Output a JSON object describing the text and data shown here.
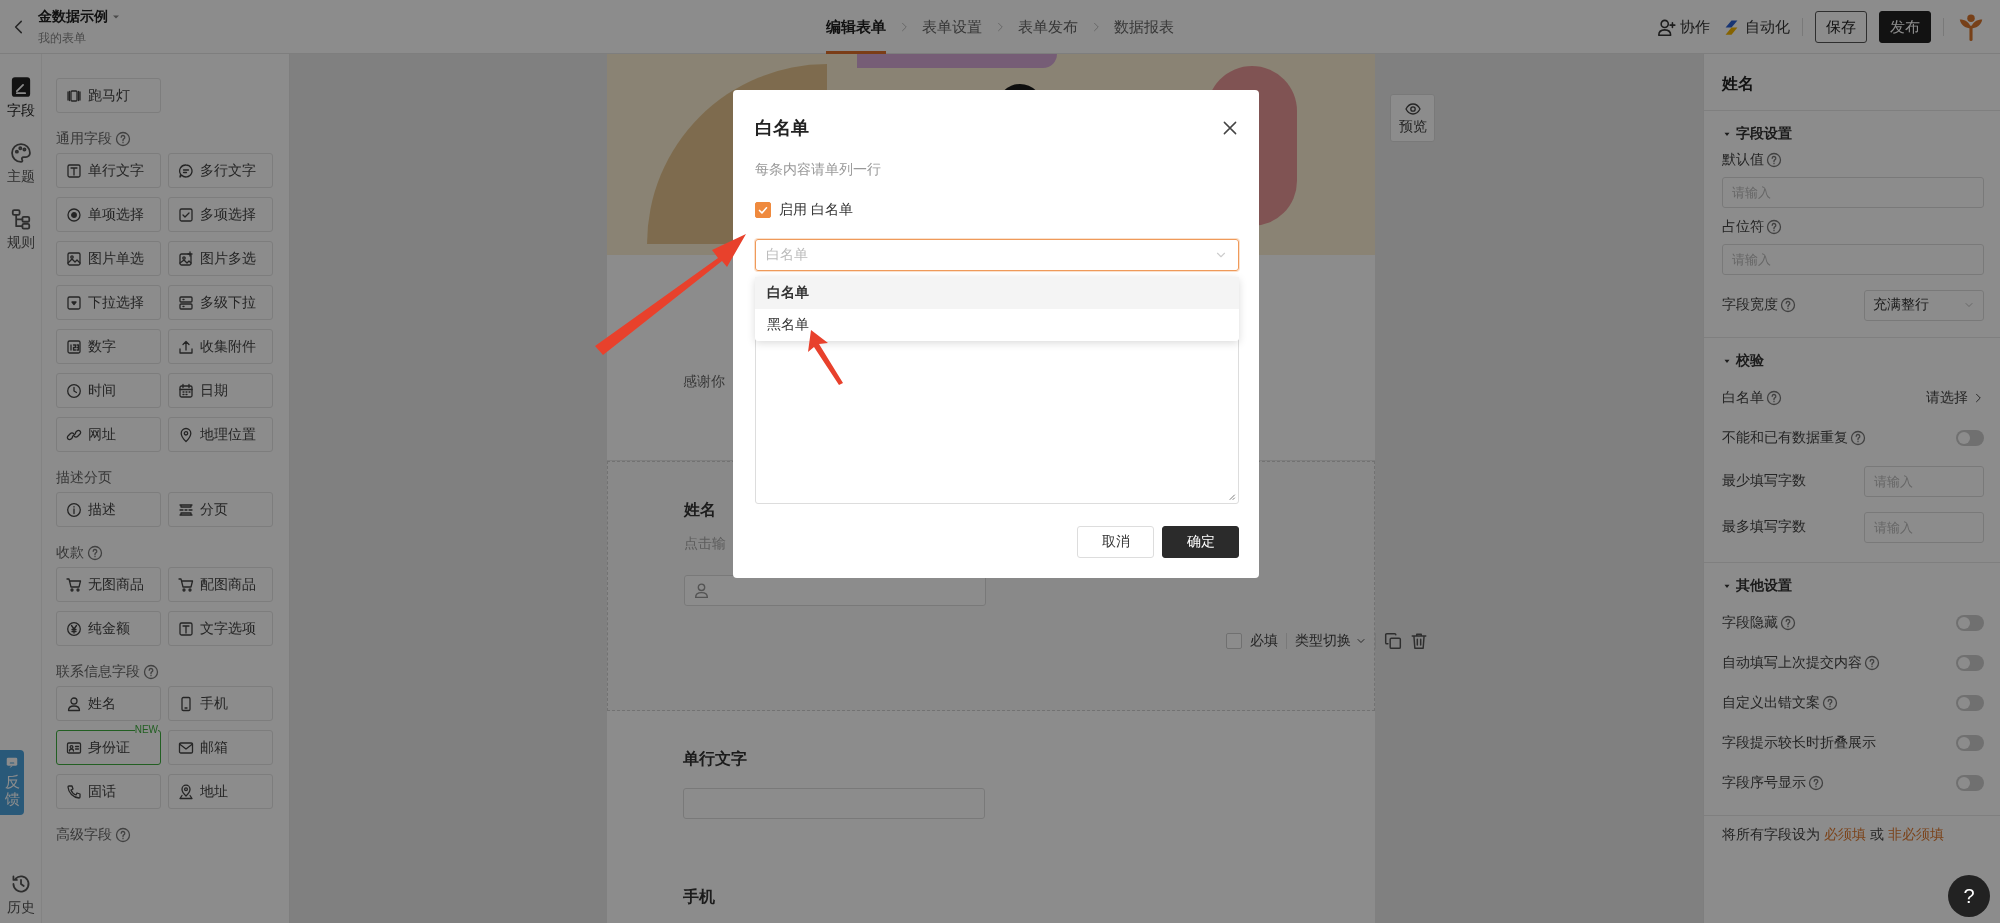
{
  "header": {
    "title": "金数据示例",
    "subtitle": "我的表单",
    "steps": [
      {
        "label": "编辑表单",
        "selected": true
      },
      {
        "label": "表单设置",
        "selected": false
      },
      {
        "label": "表单发布",
        "selected": false
      },
      {
        "label": "数据报表",
        "selected": false
      }
    ],
    "actions": [
      {
        "kind": "collaborate",
        "label": "协作"
      },
      {
        "kind": "automation",
        "label": "自动化"
      }
    ],
    "buttons": [
      {
        "label": "保存",
        "primary": false
      },
      {
        "label": "发布",
        "primary": true
      }
    ]
  },
  "rail": {
    "items": [
      {
        "kind": "field",
        "label": "字段",
        "selected": true
      },
      {
        "kind": "theme",
        "label": "主题",
        "selected": false
      },
      {
        "kind": "rule",
        "label": "规则",
        "selected": false
      }
    ],
    "feedback": "反馈",
    "history": "历史"
  },
  "palette": [
    {
      "items": [
        {
          "label": "跑马灯",
          "kind": "marquee"
        }
      ]
    },
    {
      "title": "通用字段",
      "help": true,
      "items": [
        {
          "label": "单行文字",
          "kind": "text"
        },
        {
          "label": "多行文字",
          "kind": "multitext"
        },
        {
          "label": "单项选择",
          "kind": "radio"
        },
        {
          "label": "多项选择",
          "kind": "checkbox"
        },
        {
          "label": "图片单选",
          "kind": "image"
        },
        {
          "label": "图片多选",
          "kind": "images"
        },
        {
          "label": "下拉选择",
          "kind": "dropdown"
        },
        {
          "label": "多级下拉",
          "kind": "cascade"
        },
        {
          "label": "数字",
          "kind": "number"
        },
        {
          "label": "收集附件",
          "kind": "upload"
        },
        {
          "label": "时间",
          "kind": "clock"
        },
        {
          "label": "日期",
          "kind": "calendar"
        },
        {
          "label": "网址",
          "kind": "link"
        },
        {
          "label": "地理位置",
          "kind": "pin"
        }
      ]
    },
    {
      "title": "描述分页",
      "help": false,
      "items": [
        {
          "label": "描述",
          "kind": "info"
        },
        {
          "label": "分页",
          "kind": "pagebreak"
        }
      ]
    },
    {
      "title": "收款",
      "help": true,
      "items": [
        {
          "label": "无图商品",
          "kind": "cart"
        },
        {
          "label": "配图商品",
          "kind": "cart"
        },
        {
          "label": "纯金额",
          "kind": "yuan"
        },
        {
          "label": "文字选项",
          "kind": "text"
        }
      ]
    },
    {
      "title": "联系信息字段",
      "help": true,
      "items": [
        {
          "label": "姓名",
          "kind": "person"
        },
        {
          "label": "手机",
          "kind": "phone"
        },
        {
          "label": "身份证",
          "kind": "idcard",
          "badge": "NEW"
        },
        {
          "label": "邮箱",
          "kind": "mail"
        },
        {
          "label": "固话",
          "kind": "telephone"
        },
        {
          "label": "地址",
          "kind": "location"
        }
      ]
    },
    {
      "title": "高级字段",
      "help": true
    }
  ],
  "form": {
    "intro": "感谢你",
    "fields": [
      {
        "kind": "name",
        "label": "姓名",
        "hint": "点击输",
        "selected": true,
        "required": false,
        "required_label": "必填",
        "type_switch": "类型切换"
      },
      {
        "kind": "text",
        "label": "单行文字",
        "selected": false
      },
      {
        "kind": "text",
        "label": "手机",
        "selected": false
      }
    ]
  },
  "preview": "预览",
  "inspector": {
    "title": "姓名",
    "sections": [
      {
        "title": "字段设置",
        "expanded": true,
        "rows": [
          {
            "kind": "input",
            "label": "默认值",
            "help": true,
            "placeholder": "请输入"
          },
          {
            "kind": "input",
            "label": "占位符",
            "help": true,
            "placeholder": "请输入"
          },
          {
            "kind": "select",
            "label": "字段宽度",
            "help": true,
            "value": "充满整行"
          }
        ]
      },
      {
        "title": "校验",
        "expanded": true,
        "rows": [
          {
            "kind": "link",
            "label": "白名单",
            "help": true,
            "value": "请选择"
          },
          {
            "kind": "toggle",
            "label": "不能和已有数据重复",
            "help": true,
            "on": false
          },
          {
            "kind": "number",
            "label": "最少填写字数",
            "help": false,
            "placeholder": "请输入"
          },
          {
            "kind": "number",
            "label": "最多填写字数",
            "help": false,
            "placeholder": "请输入"
          }
        ]
      },
      {
        "title": "其他设置",
        "expanded": true,
        "rows": [
          {
            "kind": "toggle",
            "label": "字段隐藏",
            "help": true,
            "on": false
          },
          {
            "kind": "toggle",
            "label": "自动填写上次提交内容",
            "help": true,
            "on": false
          },
          {
            "kind": "toggle",
            "label": "自定义出错文案",
            "help": true,
            "on": false
          },
          {
            "kind": "toggle",
            "label": "字段提示较长时折叠展示",
            "help": false,
            "on": false
          },
          {
            "kind": "toggle",
            "label": "字段序号显示",
            "help": true,
            "on": false
          }
        ]
      }
    ],
    "footer": {
      "text": "将所有字段设为",
      "link_required": "必须填",
      "conjunction": "或",
      "link_optional": "非必须填"
    }
  },
  "help_button": "?",
  "dialog": {
    "title": "白名单",
    "hint": "每条内容请单列一行",
    "enable": {
      "label": "启用 白名单",
      "checked": true
    },
    "select": {
      "placeholder": "白名单",
      "open": true,
      "options": [
        {
          "label": "白名单",
          "selected": true
        },
        {
          "label": "黑名单",
          "selected": false
        }
      ]
    },
    "buttons": [
      {
        "label": "取消",
        "primary": false
      },
      {
        "label": "确定",
        "primary": true
      }
    ]
  }
}
